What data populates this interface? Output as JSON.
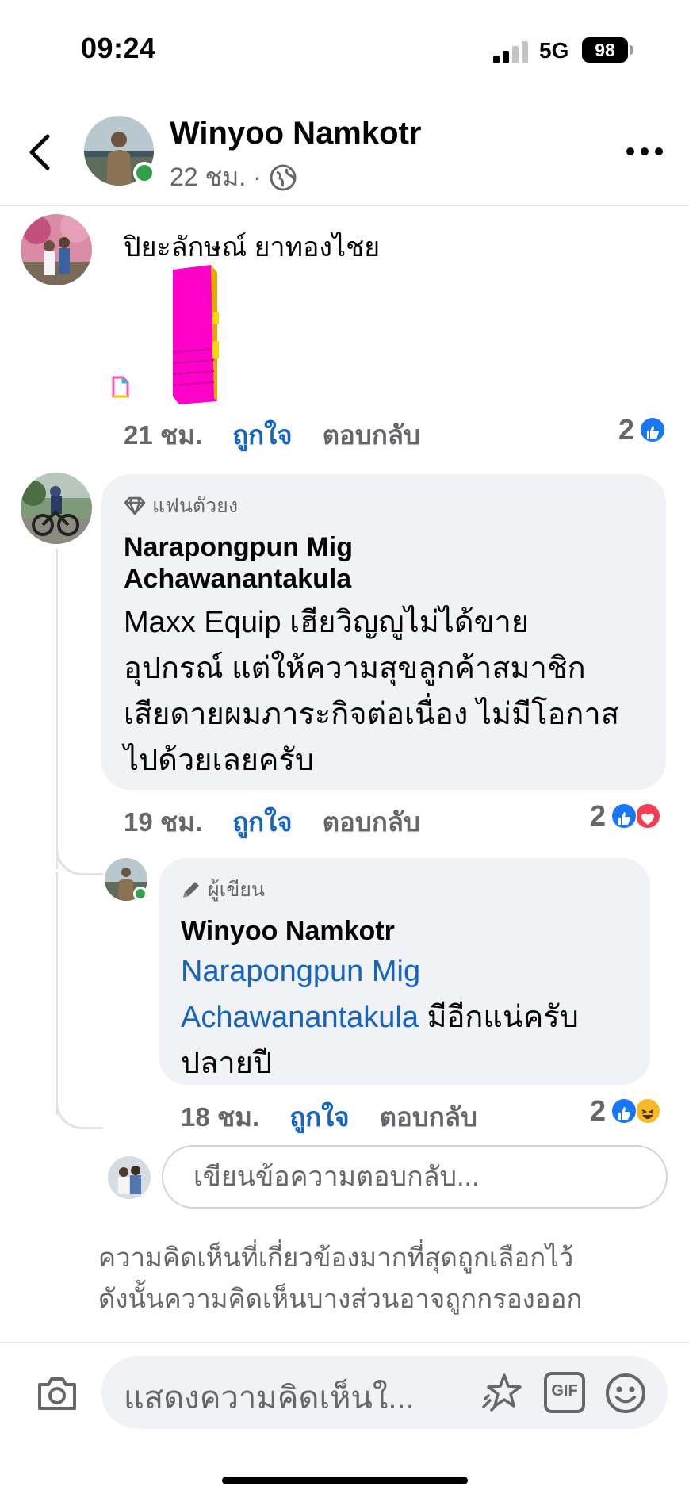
{
  "status_bar": {
    "time": "09:24",
    "network": "5G",
    "battery": "98"
  },
  "header": {
    "name": "Winyoo Namkotr",
    "meta": "22 ชม. ·",
    "icons": [
      "back-arrow-icon",
      "globe-icon",
      "more-icon"
    ]
  },
  "comments": [
    {
      "author": "ปิยะลักษณ์ ยาทองไชย",
      "attachment": "sticker",
      "time": "21 ชม.",
      "like": "ถูกใจ",
      "reply": "ตอบกลับ",
      "reaction_count": "2",
      "reactions": [
        "like"
      ]
    },
    {
      "badge": "แฟนตัวยง",
      "author_line1": "Narapongpun Mig",
      "author_line2": "Achawanantakula",
      "text_lines": [
        "Maxx Equip เฮียวิญญูไม่ได้ขาย",
        "อุปกรณ์  แต่ให้ความสุขลูกค้าสมาชิก",
        "เสียดายผมภาระกิจต่อเนื่อง ไม่มีโอกาส",
        "ไปด้วยเลยครับ"
      ],
      "time": "19 ชม.",
      "like": "ถูกใจ",
      "reply": "ตอบกลับ",
      "reaction_count": "2",
      "reactions": [
        "like",
        "love"
      ]
    },
    {
      "badge": "ผู้เขียน",
      "author": "Winyoo Namkotr",
      "mention_line1": "Narapongpun Mig",
      "mention_line2": "Achawanantakula",
      "text_after_mention": " มีอีกแน่ครับ",
      "text_line3": "ปลายปี",
      "time": "18 ชม.",
      "like": "ถูกใจ",
      "reply": "ตอบกลับ",
      "reaction_count": "2",
      "reactions": [
        "like",
        "haha"
      ]
    }
  ],
  "reply_input": {
    "placeholder": "เขียนข้อความตอบกลับ..."
  },
  "notice": {
    "line1": "ความคิดเห็นที่เกี่ยวข้องมากที่สุดถูกเลือกไว้",
    "line2": "ดังนั้นความคิดเห็นบางส่วนอาจถูกกรองออก"
  },
  "composer": {
    "placeholder": "แสดงความคิดเห็นใ...",
    "gif_label": "GIF",
    "icons": [
      "camera-icon",
      "avatar-sticker-icon",
      "gif-icon",
      "emoji-icon"
    ]
  },
  "colors": {
    "accent": "#1565c0",
    "like_blue": "#1877f2",
    "love_red": "#f33e58",
    "bubble": "#f0f2f5",
    "online": "#31a24c"
  }
}
